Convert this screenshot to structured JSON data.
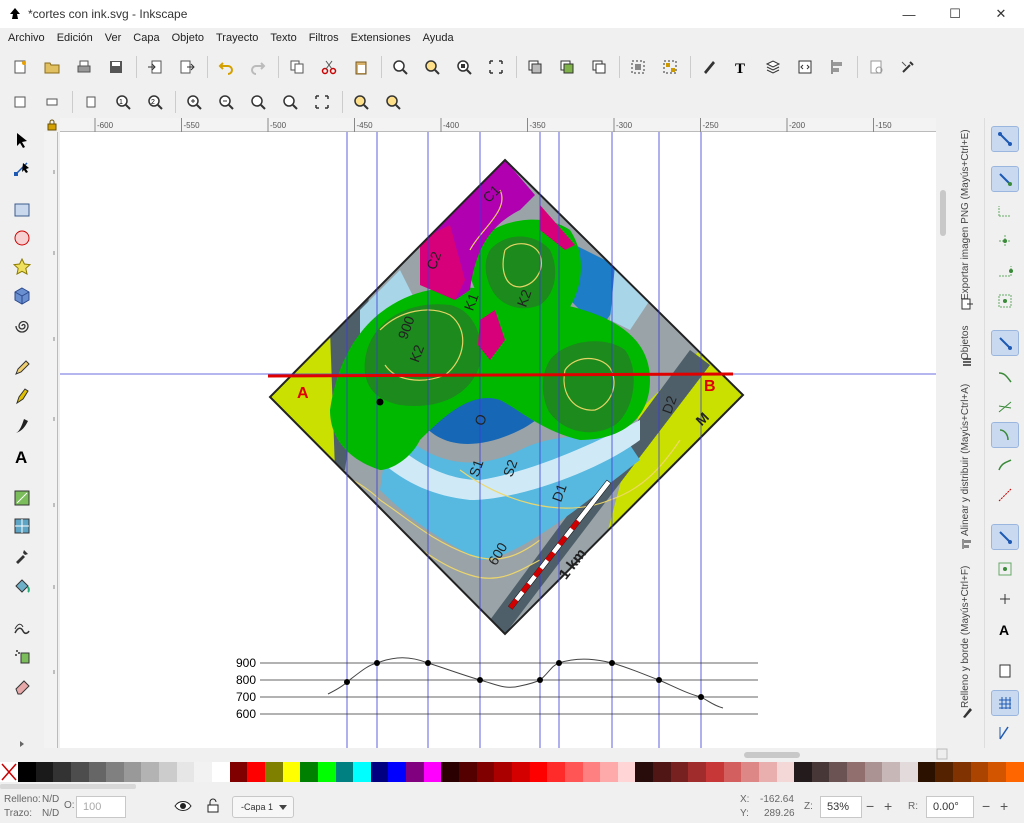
{
  "window": {
    "title": "*cortes con ink.svg - Inkscape",
    "minimize": "—",
    "maximize": "☐",
    "close": "✕"
  },
  "menu": [
    "Archivo",
    "Edición",
    "Ver",
    "Capa",
    "Objeto",
    "Trayecto",
    "Texto",
    "Filtros",
    "Extensiones",
    "Ayuda"
  ],
  "ruler_top_labels": [
    "-600",
    "-550",
    "-500",
    "-450",
    "-400",
    "-350",
    "-300",
    "-250",
    "-200",
    "-150"
  ],
  "map": {
    "labels": [
      "C1",
      "C2",
      "K1",
      "K2",
      "900",
      "K2",
      "O",
      "S1",
      "S2",
      "D1",
      "D2",
      "M",
      "600",
      "1 km"
    ],
    "endpoint_a": "A",
    "endpoint_b": "B"
  },
  "profile": {
    "elevations": [
      "900",
      "800",
      "700",
      "600"
    ]
  },
  "dock_tabs": [
    "Exportar imagen PNG (Mayús+Ctrl+E)",
    "Objetos",
    "Alinear y distribuir (Mayús+Ctrl+A)",
    "Relleno y borde (Mayús+Ctrl+F)"
  ],
  "palette": [
    "#000000",
    "#1a1a1a",
    "#333333",
    "#4d4d4d",
    "#666666",
    "#808080",
    "#999999",
    "#b3b3b3",
    "#cccccc",
    "#e6e6e6",
    "#f2f2f2",
    "#ffffff",
    "#800000",
    "#ff0000",
    "#808000",
    "#ffff00",
    "#008000",
    "#00ff00",
    "#008080",
    "#00ffff",
    "#000080",
    "#0000ff",
    "#800080",
    "#ff00ff",
    "#2b0000",
    "#550000",
    "#800000",
    "#aa0000",
    "#d40000",
    "#ff0000",
    "#ff2a2a",
    "#ff5555",
    "#ff8080",
    "#ffaaaa",
    "#ffd5d5",
    "#280b0b",
    "#501616",
    "#782121",
    "#a02c2c",
    "#c83737",
    "#d35f5f",
    "#de8787",
    "#e9afaf",
    "#f4d7d7",
    "#241c1c",
    "#483737",
    "#6c5353",
    "#916f6f",
    "#ac9393",
    "#c8b7b7",
    "#e3dbdb",
    "#2b1100",
    "#552200",
    "#803300",
    "#aa4400",
    "#d45500",
    "#ff6600"
  ],
  "status": {
    "fill_label": "Relleno:",
    "fill_value": "N/D",
    "stroke_label": "Trazo:",
    "stroke_value": "N/D",
    "opacity_label": "O:",
    "opacity_value": "100",
    "layer": "-Capa 1",
    "x_label": "X:",
    "x_value": "-162.64",
    "y_label": "Y:",
    "y_value": "289.26",
    "zoom_label": "Z:",
    "zoom_value": "53%",
    "rotation_label": "R:",
    "rotation_value": "0.00°"
  }
}
